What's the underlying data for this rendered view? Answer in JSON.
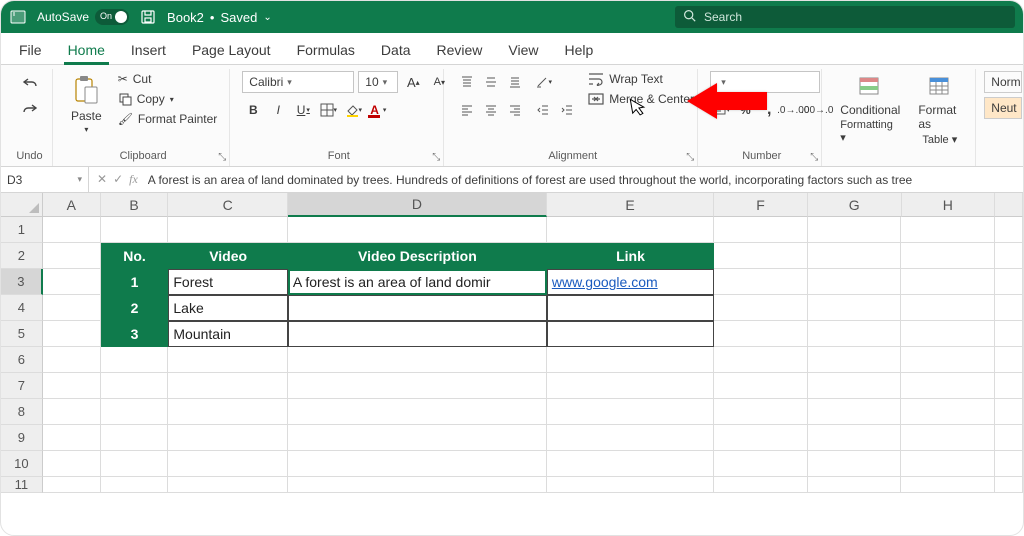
{
  "titlebar": {
    "autosave_label": "AutoSave",
    "autosave_state": "On",
    "doc_name": "Book2",
    "doc_status": "Saved",
    "search_placeholder": "Search"
  },
  "tabs": [
    "File",
    "Home",
    "Insert",
    "Page Layout",
    "Formulas",
    "Data",
    "Review",
    "View",
    "Help"
  ],
  "active_tab": "Home",
  "ribbon": {
    "undo": {
      "label": "Undo"
    },
    "clipboard": {
      "paste": "Paste",
      "cut": "Cut",
      "copy": "Copy",
      "format_painter": "Format Painter",
      "group": "Clipboard"
    },
    "font": {
      "name": "Calibri",
      "size": "10",
      "group": "Font"
    },
    "alignment": {
      "wrap": "Wrap Text",
      "merge": "Merge & Center",
      "group": "Alignment"
    },
    "number": {
      "group": "Number"
    },
    "styles": {
      "conditional": "Conditional",
      "conditional2": "Formatting",
      "formatas": "Format as",
      "formatas2": "Table",
      "norm": "Norm",
      "neut": "Neut"
    }
  },
  "formula": {
    "cell_ref": "D3",
    "text": "A forest is an area of land dominated by trees. Hundreds of definitions of forest are used throughout the world, incorporating factors such as tree"
  },
  "columns": [
    "A",
    "B",
    "C",
    "D",
    "E",
    "F",
    "G",
    "H"
  ],
  "row_labels": [
    "1",
    "2",
    "3",
    "4",
    "5",
    "6",
    "7",
    "8",
    "9",
    "10",
    "11"
  ],
  "table": {
    "headers": {
      "no": "No.",
      "video": "Video",
      "desc": "Video Description",
      "link": "Link"
    },
    "rows": [
      {
        "no": "1",
        "video": "Forest",
        "desc": "A forest is an area of land domir",
        "link": "www.google.com"
      },
      {
        "no": "2",
        "video": "Lake",
        "desc": "",
        "link": ""
      },
      {
        "no": "3",
        "video": "Mountain",
        "desc": "",
        "link": ""
      }
    ]
  }
}
